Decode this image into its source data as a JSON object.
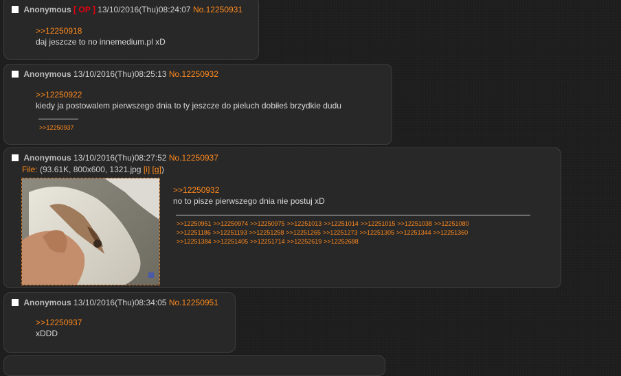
{
  "posts": [
    {
      "name": "Anonymous",
      "op_badge": "[ OP ]",
      "date": "13/10/2016(Thu)08:24:07",
      "number": "No.12250931",
      "quote": ">>12250918",
      "text": "daj jeszcze to no innemedium.pl xD"
    },
    {
      "name": "Anonymous",
      "date": "13/10/2016(Thu)08:25:13",
      "number": "No.12250932",
      "quote": ">>12250922",
      "text": "kiedy ja postowalem pierwszego dnia to ty jeszcze do pieluch dobiłeś brzydkie dudu",
      "backlinks": [
        ">>12250937"
      ]
    },
    {
      "name": "Anonymous",
      "date": "13/10/2016(Thu)08:27:52",
      "number": "No.12250937",
      "file_label": "File:",
      "file_info": "(93.61K, 800x600, 1321.jpg",
      "file_link_i": "[i]",
      "file_link_g": "[g]",
      "file_close": ")",
      "quote": ">>12250932",
      "text": "no to pisze pierwszego dnia nie postuj xD",
      "backlinks": [
        ">>12250951",
        ">>12250974",
        ">>12250975",
        ">>12251013",
        ">>12251014",
        ">>12251015",
        ">>12251038",
        ">>12251080",
        ">>12251186",
        ">>12251193",
        ">>12251258",
        ">>12251265",
        ">>12251273",
        ">>12251305",
        ">>12251344",
        ">>12251360",
        ">>12251384",
        ">>12251405",
        ">>12251714",
        ">>12252619",
        ">>12252688"
      ]
    },
    {
      "name": "Anonymous",
      "date": "13/10/2016(Thu)08:34:05",
      "number": "No.12250951",
      "quote": ">>12250937",
      "text": "xDDD"
    }
  ],
  "colors": {
    "accent": "#ff8a1e",
    "op": "#e3000f",
    "post_bg": "#282828",
    "page_bg": "#1d1d1d"
  }
}
